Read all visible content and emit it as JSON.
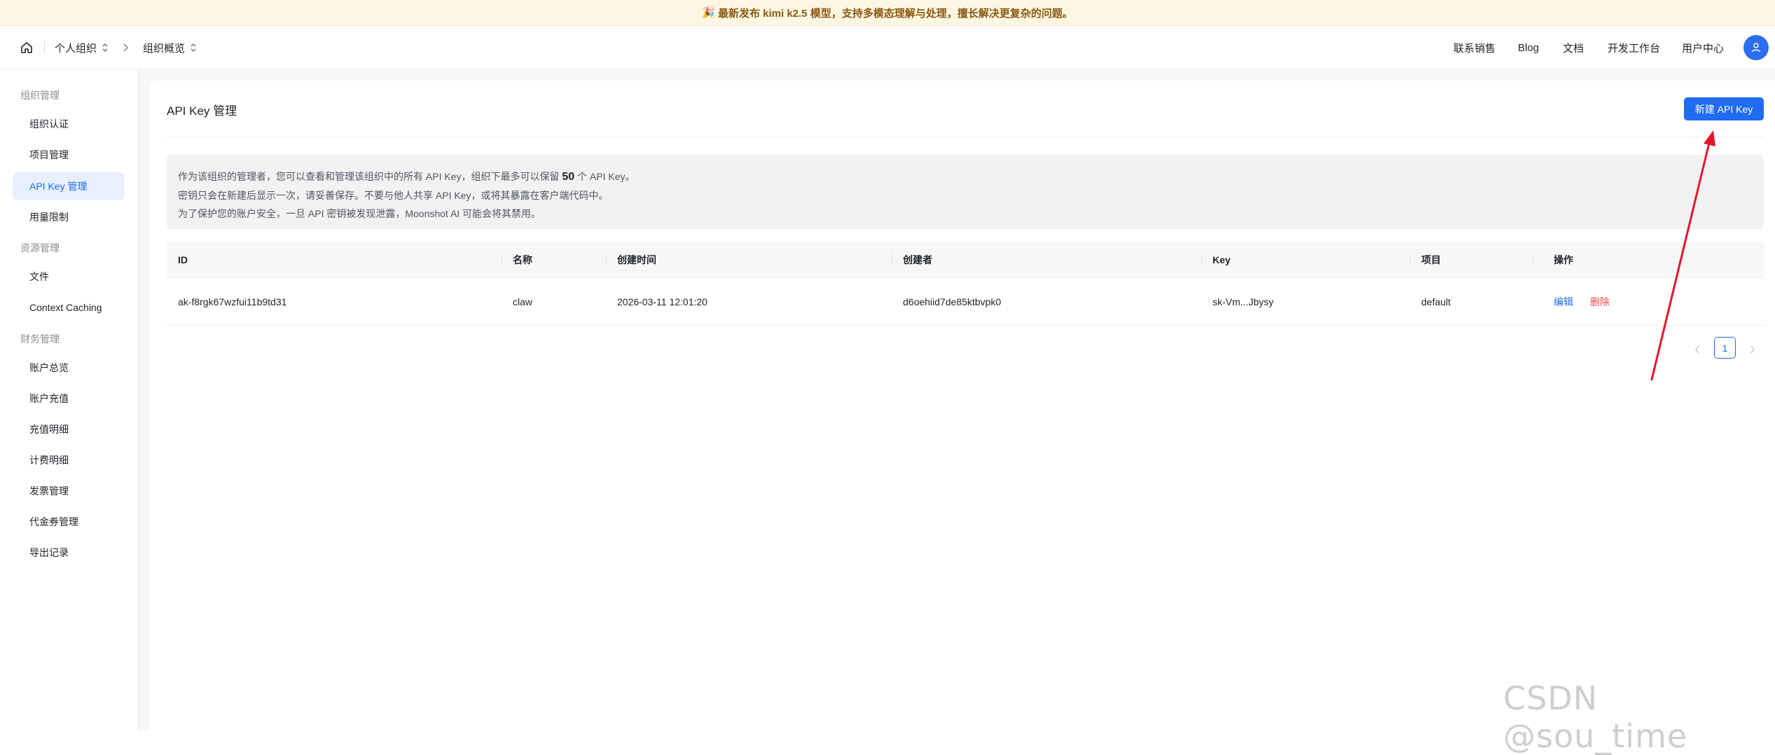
{
  "banner": {
    "text": "最新发布 kimi k2.5 模型，支持多模态理解与处理，擅长解决更复杂的问题。"
  },
  "header": {
    "org": "个人组织",
    "page": "组织概览",
    "nav": [
      "联系销售",
      "Blog",
      "文档",
      "开发工作台",
      "用户中心"
    ]
  },
  "sidebar": {
    "groups": [
      "组织管理",
      "资源管理",
      "财务管理"
    ],
    "items": [
      "组织认证",
      "项目管理",
      "API Key 管理",
      "用量限制",
      "文件",
      "Context Caching",
      "账户总览",
      "账户充值",
      "充值明细",
      "计费明细",
      "发票管理",
      "代金券管理",
      "导出记录"
    ],
    "active": "API Key 管理"
  },
  "main": {
    "title": "API Key 管理",
    "new_button": "新建 API Key",
    "notice": {
      "line1_before": "作为该组织的管理者，您可以查看和管理该组织中的所有 API Key，组织下最多可以保留",
      "line1_number": "50",
      "line1_after": "个 API Key。",
      "line2": "密钥只会在新建后显示一次，请妥善保存。不要与他人共享 API Key，或将其暴露在客户端代码中。",
      "line3": "为了保护您的账户安全，一旦 API 密钥被发现泄露，Moonshot AI 可能会将其禁用。"
    },
    "table": {
      "columns": [
        "ID",
        "名称",
        "创建时间",
        "创建者",
        "Key",
        "项目",
        "操作"
      ],
      "rows": [
        {
          "id": "ak-f8rgk67wzfui11b9td31",
          "name": "claw",
          "created": "2026-03-11 12:01:20",
          "creator": "d6oehiid7de85ktbvpk0",
          "key": "sk-Vm...Jbysy",
          "project": "default",
          "edit": "编辑",
          "delete": "删除"
        }
      ]
    },
    "pagination": {
      "current": "1"
    }
  },
  "watermark": "CSDN @sou_time",
  "colors": {
    "primary": "#1f6bf2",
    "danger": "#f24a4a",
    "annotation_arrow": "#e8142c",
    "banner_bg": "#fdf6e3"
  }
}
